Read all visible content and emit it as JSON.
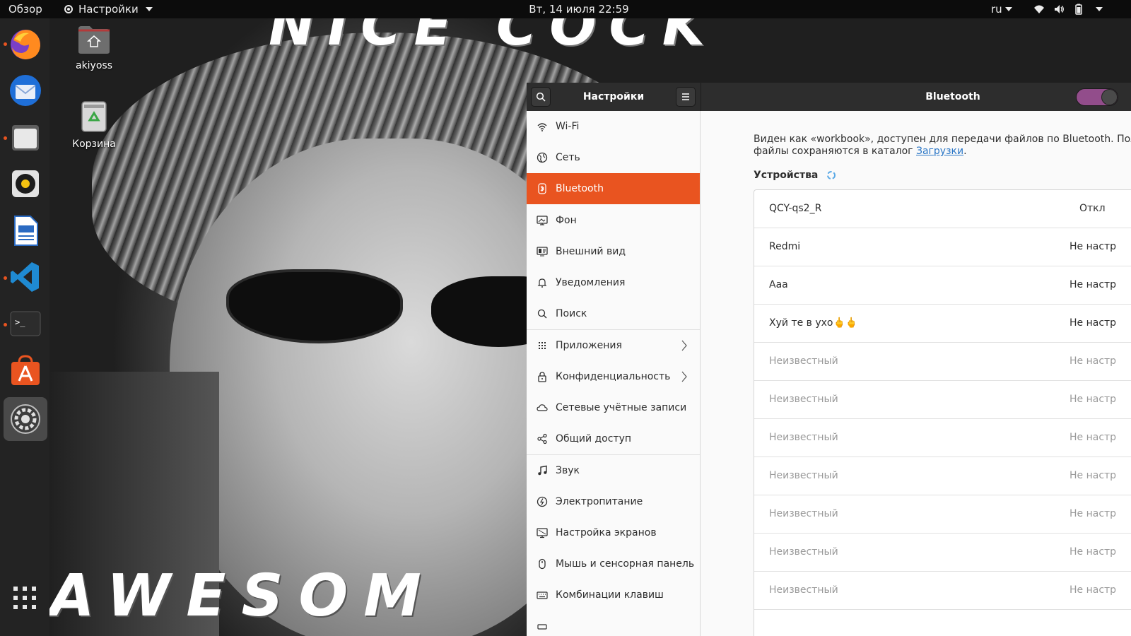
{
  "topbar": {
    "overview": "Обзор",
    "app_menu": "Настройки",
    "clock": "Вт, 14 июля  22:59",
    "language": "ru"
  },
  "dock": {
    "apps": [
      "firefox-icon",
      "thunderbird-icon",
      "files-icon",
      "rhythmbox-icon",
      "libreoffice-writer-icon",
      "vscode-icon",
      "terminal-icon",
      "ubuntu-software-icon",
      "settings-icon"
    ]
  },
  "wallpaper": {
    "top_text": "NICE COCK",
    "bottom_text": "AWESOM"
  },
  "desktop": {
    "home_label": "akiyoss",
    "trash_label": "Корзина"
  },
  "settings": {
    "sidebar_title": "Настройки",
    "page_title": "Bluetooth",
    "bluetooth_enabled": true,
    "nav": [
      {
        "label": "Wi-Fi",
        "icon": "wifi-icon"
      },
      {
        "label": "Сеть",
        "icon": "network-icon"
      },
      {
        "label": "Bluetooth",
        "icon": "bluetooth-icon",
        "active": true
      },
      {
        "label": "Фон",
        "icon": "background-icon"
      },
      {
        "label": "Внешний вид",
        "icon": "appearance-icon"
      },
      {
        "label": "Уведомления",
        "icon": "bell-icon"
      },
      {
        "label": "Поиск",
        "icon": "search-icon"
      },
      {
        "label": "Приложения",
        "icon": "apps-grid-icon",
        "submenu": true
      },
      {
        "label": "Конфиденциальность",
        "icon": "lock-icon",
        "submenu": true
      },
      {
        "label": "Сетевые учётные записи",
        "icon": "cloud-icon"
      },
      {
        "label": "Общий доступ",
        "icon": "share-icon"
      },
      {
        "label": "Звук",
        "icon": "music-note-icon"
      },
      {
        "label": "Электропитание",
        "icon": "power-icon"
      },
      {
        "label": "Настройка экранов",
        "icon": "display-icon"
      },
      {
        "label": "Мышь и сенсорная панель",
        "icon": "mouse-icon"
      },
      {
        "label": "Комбинации клавиш",
        "icon": "keyboard-icon"
      }
    ],
    "info_line1": "Виден как «workbook», доступен для передачи файлов по Bluetooth. Пол",
    "info_line2_prefix": "файлы сохраняются в каталог ",
    "info_link": "Загрузки",
    "info_line2_suffix": ".",
    "devices_heading": "Устройства",
    "devices": [
      {
        "name": "QCY-qs2_R",
        "status": "Откл"
      },
      {
        "name": "Redmi",
        "status": "Не настр"
      },
      {
        "name": "Aaa",
        "status": "Не настр"
      },
      {
        "name": "Хуй те в ухо🖕🖕",
        "status": "Не настр"
      },
      {
        "name": "Неизвестный",
        "status": "Не настр",
        "dim": true
      },
      {
        "name": "Неизвестный",
        "status": "Не настр",
        "dim": true
      },
      {
        "name": "Неизвестный",
        "status": "Не настр",
        "dim": true
      },
      {
        "name": "Неизвестный",
        "status": "Не настр",
        "dim": true
      },
      {
        "name": "Неизвестный",
        "status": "Не настр",
        "dim": true
      },
      {
        "name": "Неизвестный",
        "status": "Не настр",
        "dim": true
      },
      {
        "name": "Неизвестный",
        "status": "Не настр",
        "dim": true
      }
    ]
  },
  "colors": {
    "accent": "#e95420",
    "switch_on": "#924d8b",
    "link": "#2a76c6"
  }
}
